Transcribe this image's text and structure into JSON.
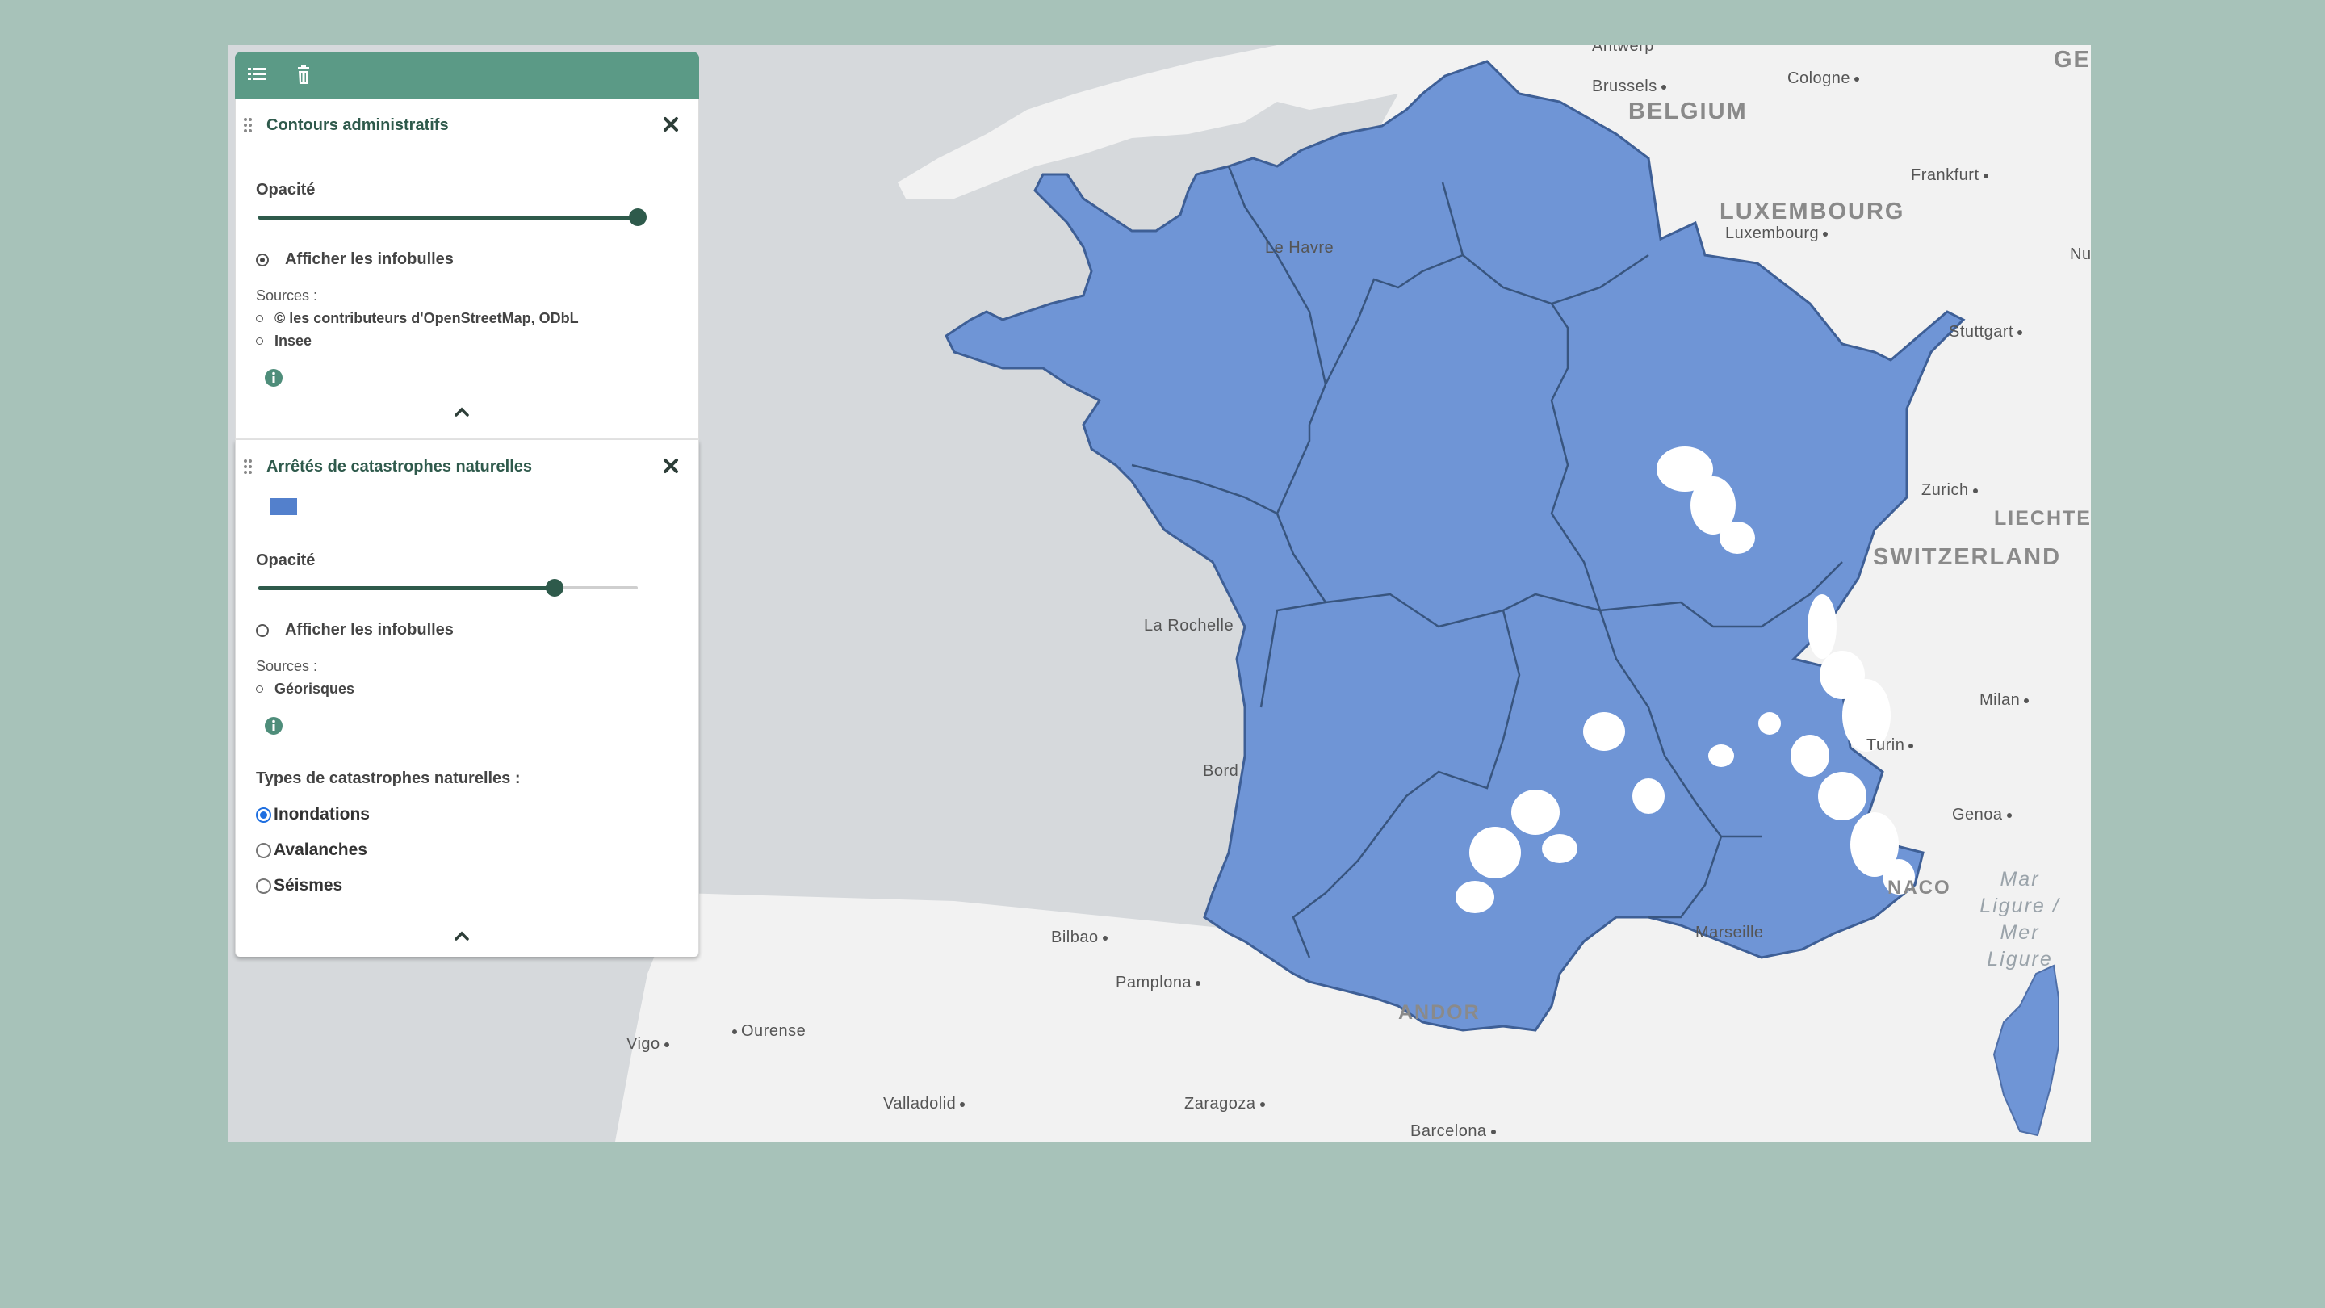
{
  "toolbar": {
    "list_icon": "list-icon",
    "trash_icon": "trash-icon",
    "color": "#5b9a86"
  },
  "layers": [
    {
      "title": "Contours administratifs",
      "opacity_label": "Opacité",
      "opacity_value": 1.0,
      "tooltip_label": "Afficher les infobulles",
      "tooltip_checked": true,
      "sources_label": "Sources :",
      "sources": [
        "© les contributeurs d'OpenStreetMap, ODbL",
        "Insee"
      ]
    },
    {
      "title": "Arrêtés de catastrophes naturelles",
      "legend_color": "#5380cc",
      "opacity_label": "Opacité",
      "opacity_value": 0.78,
      "tooltip_label": "Afficher les infobulles",
      "tooltip_checked": false,
      "sources_label": "Sources :",
      "sources": [
        "Géorisques"
      ],
      "types_label": "Types de catastrophes naturelles :",
      "types": [
        {
          "label": "Inondations",
          "selected": true
        },
        {
          "label": "Avalanches",
          "selected": false
        },
        {
          "label": "Séismes",
          "selected": false
        }
      ]
    }
  ],
  "map": {
    "cities": {
      "antwerp": "Antwerp",
      "brussels": "Brussels",
      "cologne": "Cologne",
      "frankfurt": "Frankfurt",
      "luxembourg_city": "Luxembourg",
      "stuttgart": "Stuttgart",
      "le_havre": "Le Havre",
      "la_rochelle": "La Rochelle",
      "bordeaux": "Bord",
      "zurich": "Zurich",
      "milan": "Milan",
      "turin": "Turin",
      "genoa": "Genoa",
      "marseille": "Marseille",
      "bilbao": "Bilbao",
      "pamplona": "Pamplona",
      "ourense": "Ourense",
      "vigo": "Vigo",
      "valladolid": "Valladolid",
      "zaragoza": "Zaragoza",
      "barcelona": "Barcelona",
      "nu": "Nu"
    },
    "countries": {
      "belgium": "BELGIUM",
      "luxembourg": "LUXEMBOURG",
      "switzerland": "SWITZERLAND",
      "liechtenstein": "LIECHTENS",
      "andorra": "ANDOR",
      "monaco": "NACO",
      "germany": "GE"
    },
    "sea": "Mar\nLigure /\nMer\nLigure",
    "fill_color": "#6f95d6",
    "land_color": "#f2f2f2",
    "sea_color": "#d6d9dc"
  }
}
